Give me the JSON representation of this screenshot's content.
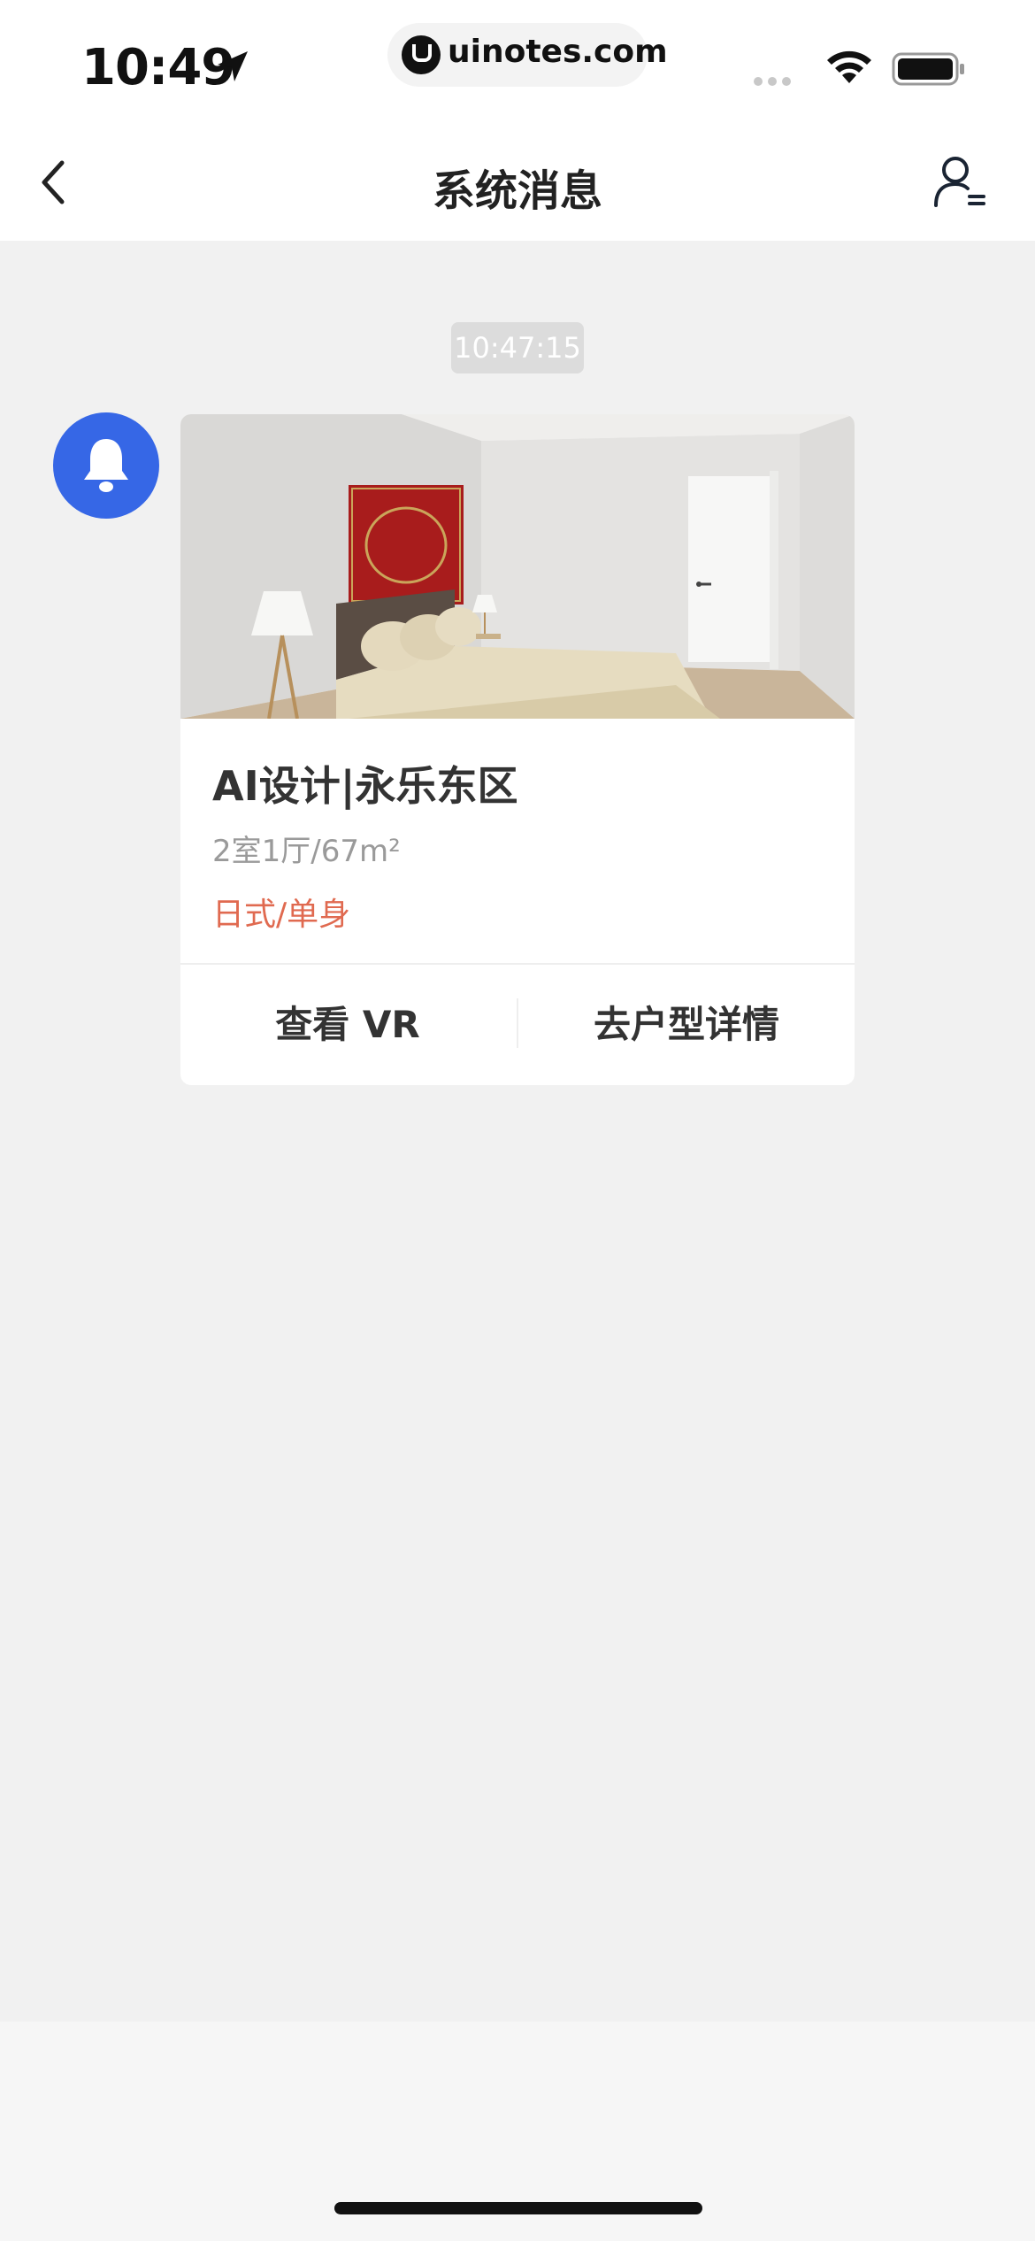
{
  "status_bar": {
    "time": "10:49",
    "url": "uinotes.com"
  },
  "nav": {
    "title": "系统消息"
  },
  "message": {
    "timestamp": "10:47:15",
    "card": {
      "title": "AI设计|永乐东区",
      "spec": "2室1厅/67m²",
      "style": "日式/单身",
      "button_vr": "查看 VR",
      "button_detail": "去户型详情"
    }
  },
  "colors": {
    "accent_blue": "#3667e6",
    "style_red": "#e06a50",
    "background": "#f1f1f1"
  },
  "icons": {
    "back": "chevron-left-icon",
    "user": "user-list-icon",
    "bell": "bell-icon",
    "location": "location-arrow-icon",
    "wifi": "wifi-icon",
    "battery": "battery-icon"
  }
}
